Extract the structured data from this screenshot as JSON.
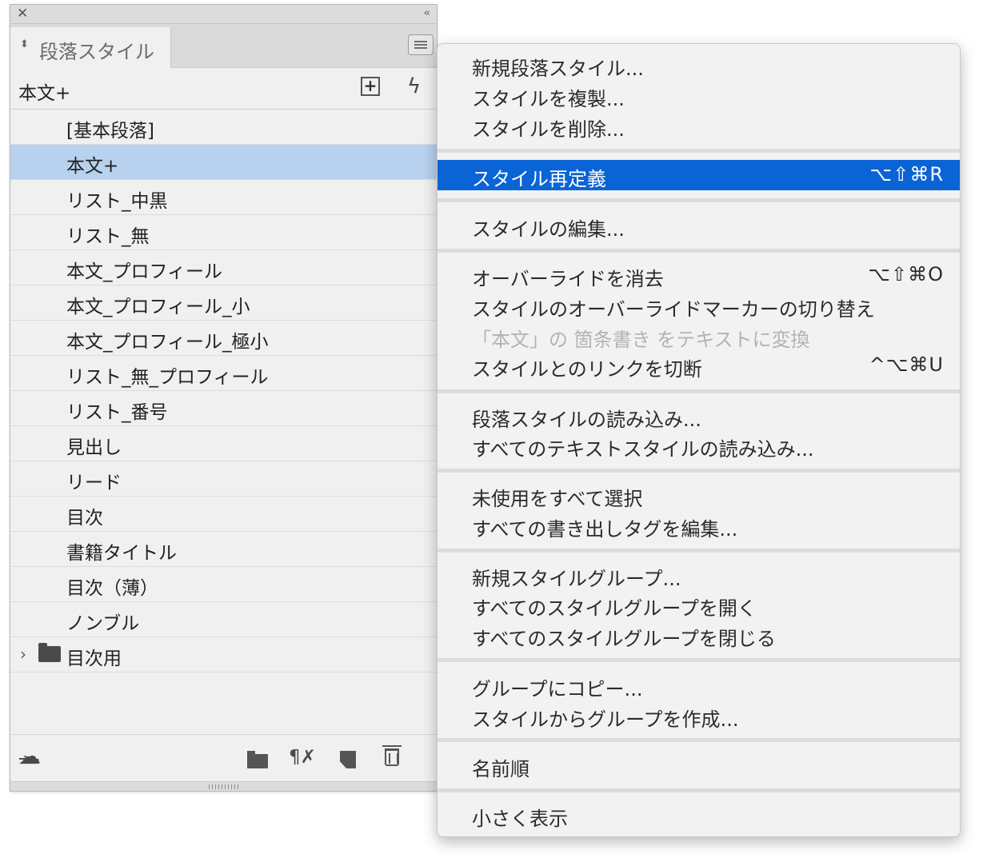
{
  "panel": {
    "tab_label": "段落スタイル",
    "current_style": "本文+",
    "styles": [
      "[基本段落]",
      "本文+",
      "リスト_中黒",
      "リスト_無",
      "本文_プロフィール",
      "本文_プロフィール_小",
      "本文_プロフィール_極小",
      "リスト_無_プロフィール",
      "リスト_番号",
      "見出し",
      "リード",
      "目次",
      "書籍タイトル",
      "目次（薄）",
      "ノンブル"
    ],
    "selected_style": "本文+",
    "group": "目次用"
  },
  "menu": {
    "items": [
      {
        "label": "新規段落スタイル...",
        "shortcut": ""
      },
      {
        "label": "スタイルを複製...",
        "shortcut": ""
      },
      {
        "label": "スタイルを削除...",
        "shortcut": ""
      },
      {
        "label": "スタイル再定義",
        "shortcut": "⌥⇧⌘R",
        "highlighted": true
      },
      {
        "label": "スタイルの編集...",
        "shortcut": ""
      },
      {
        "label": "オーバーライドを消去",
        "shortcut": "⌥⇧⌘O"
      },
      {
        "label": "スタイルのオーバーライドマーカーの切り替え",
        "shortcut": ""
      },
      {
        "label": "「本文」の 箇条書き をテキストに変換",
        "shortcut": "",
        "disabled": true
      },
      {
        "label": "スタイルとのリンクを切断",
        "shortcut": "^⌥⌘U"
      },
      {
        "label": "段落スタイルの読み込み...",
        "shortcut": ""
      },
      {
        "label": "すべてのテキストスタイルの読み込み...",
        "shortcut": ""
      },
      {
        "label": "未使用をすべて選択",
        "shortcut": ""
      },
      {
        "label": "すべての書き出しタグを編集...",
        "shortcut": ""
      },
      {
        "label": "新規スタイルグループ...",
        "shortcut": ""
      },
      {
        "label": "すべてのスタイルグループを開く",
        "shortcut": ""
      },
      {
        "label": "すべてのスタイルグループを閉じる",
        "shortcut": ""
      },
      {
        "label": "グループにコピー...",
        "shortcut": ""
      },
      {
        "label": "スタイルからグループを作成...",
        "shortcut": ""
      },
      {
        "label": "名前順",
        "shortcut": ""
      },
      {
        "label": "小さく表示",
        "shortcut": ""
      }
    ]
  },
  "colors": {
    "highlight": "#0a64d6",
    "selected_row": "#b7d1ef"
  }
}
